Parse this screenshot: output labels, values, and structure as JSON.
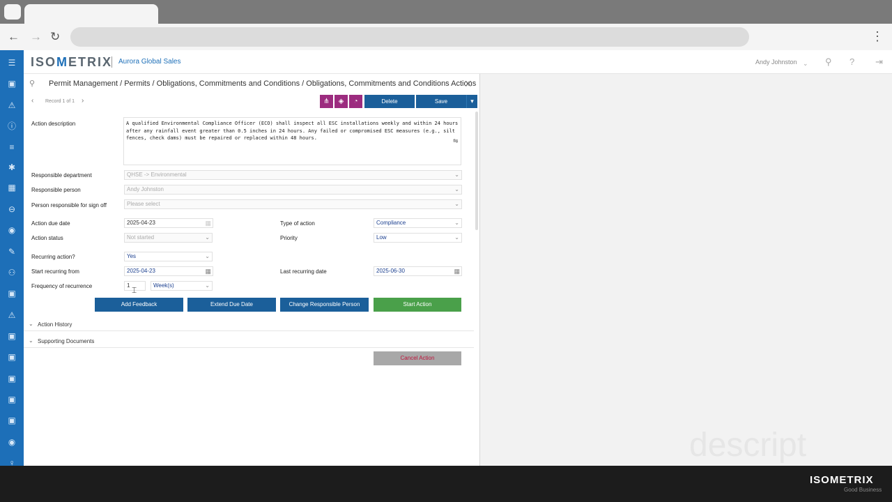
{
  "app": {
    "logo": {
      "pre": "ISO",
      "mark": "M",
      "post": "ETRIX"
    },
    "company": "Aurora Global Sales",
    "user": "Andy Johnston",
    "watermark": "descript"
  },
  "breadcrumb": "Permit Management / Permits / Obligations, Commitments and Conditions / Obligations, Commitments and Conditions Actions",
  "toolbar": {
    "record_count": "Record 1 of 1",
    "delete_label": "Delete",
    "save_label": "Save"
  },
  "form": {
    "action_description_label": "Action description",
    "action_description": "A qualified Environmental Compliance Officer (ECO) shall inspect all ESC installations weekly and within 24 hours after any rainfall event greater than 0.5 inches in 24 hours. Any failed or compromised ESC measures (e.g., silt fences, check dams) must be repaired or replaced within 48 hours.",
    "responsible_department_label": "Responsible department",
    "responsible_department": "QHSE -> Environmental",
    "responsible_person_label": "Responsible person",
    "responsible_person": "Andy Johnston",
    "signoff_label": "Person responsible for sign off",
    "signoff_placeholder": "Please select",
    "due_date_label": "Action due date",
    "due_date": "2025-04-23",
    "type_label": "Type of action",
    "type": "Compliance",
    "status_label": "Action status",
    "status": "Not started",
    "priority_label": "Priority",
    "priority": "Low",
    "recurring_label": "Recurring action?",
    "recurring": "Yes",
    "start_recurring_label": "Start recurring from",
    "start_recurring": "2025-04-23",
    "last_recurring_label": "Last recurring date",
    "last_recurring": "2025-06-30",
    "frequency_label": "Frequency of recurrence",
    "frequency_value": "1",
    "frequency_unit": "Week(s)"
  },
  "actions": {
    "add_feedback": "Add Feedback",
    "extend_due_date": "Extend Due Date",
    "change_person": "Change Responsible Person",
    "start_action": "Start Action",
    "cancel_action": "Cancel Action"
  },
  "sections": {
    "history": "Action History",
    "documents": "Supporting Documents"
  },
  "footer": {
    "brand": "ISOMETRIX",
    "tagline": "Good Business"
  },
  "colors": {
    "rail": "#1d6fb8",
    "primary_button": "#1b5f9a",
    "start_button": "#4aa04a",
    "toolbar_icon": "#9c2c7f",
    "cancel_text": "#c0143c"
  },
  "icons": [
    "back-icon",
    "forward-icon",
    "reload-icon",
    "search-icon",
    "close-icon",
    "help-icon",
    "logout-icon",
    "calendar-icon",
    "chevron-down-icon",
    "hierarchy-icon",
    "layers-icon",
    "tag-icon"
  ]
}
